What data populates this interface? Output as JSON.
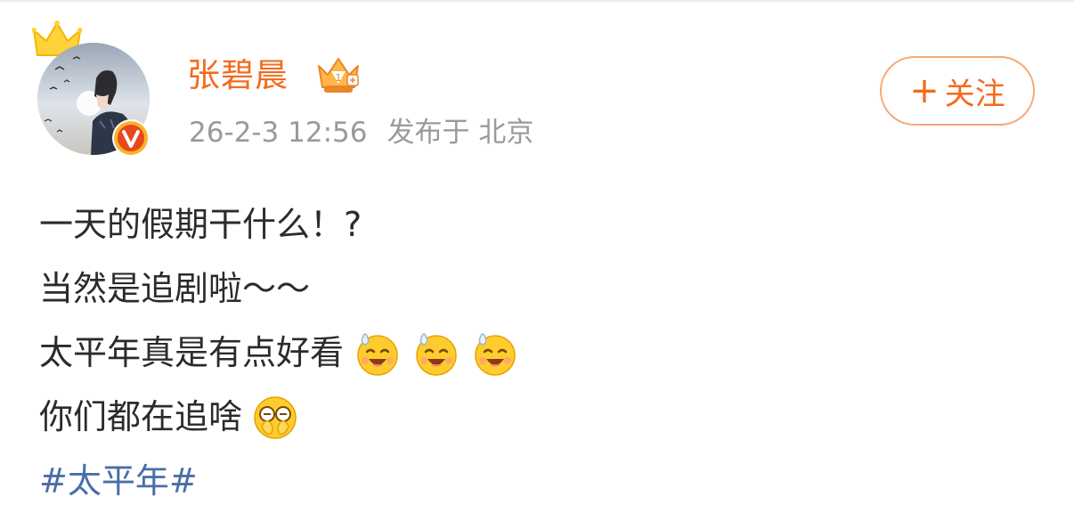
{
  "post": {
    "author": "张碧晨",
    "time": "26-2-3 12:56",
    "location_prefix": "发布于",
    "location": "北京",
    "follow_label": "关注",
    "follow_plus": "+",
    "lines": [
      "一天的假期干什么！?",
      "当然是追剧啦～～",
      "太平年真是有点好看",
      "你们都在追啥"
    ],
    "hashtag": "#太平年#"
  },
  "icons": {
    "crown": "crown-icon",
    "verified": "verified-v-icon",
    "member": "vip-member-crown-icon",
    "emoji_sweat_smile": "sweat-smile-emoji",
    "emoji_cover_face": "cover-face-emoji"
  },
  "colors": {
    "accent": "#f26b1d",
    "follow_border": "#f7a874",
    "meta_text": "#9a9a9a",
    "body_text": "#2b2b2b",
    "hashtag": "#4a6ea8"
  }
}
